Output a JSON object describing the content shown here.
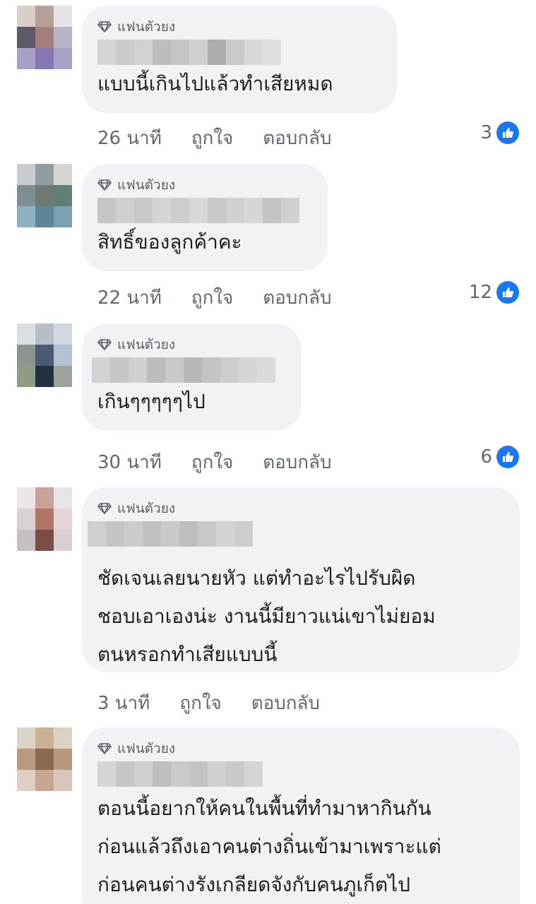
{
  "comments": [
    {
      "badge": "แฟนตัวยง",
      "text": "แบบนี้เกินไปแล้วทำเสียหมด",
      "time": "26 นาที",
      "like_label": "ถูกใจ",
      "reply_label": "ตอบกลับ",
      "reaction_count": "3"
    },
    {
      "badge": "แฟนตัวยง",
      "text": "สิทธิ์ของลูกค้าคะ",
      "time": "22 นาที",
      "like_label": "ถูกใจ",
      "reply_label": "ตอบกลับ",
      "reaction_count": "12"
    },
    {
      "badge": "แฟนตัวยง",
      "text": "เกินๆๆๆๆๆไป",
      "time": "30 นาที",
      "like_label": "ถูกใจ",
      "reply_label": "ตอบกลับ",
      "reaction_count": "6"
    },
    {
      "badge": "แฟนตัวยง",
      "text": "ชัดเจนเลยนายหัว แต่ทำอะไรไปรับผิด\nชอบเอาเองน่ะ งานนี้มียาวแน่เขาไม่ยอม\nตนหรอกทำเสียแบบนี้",
      "time": "3 นาที",
      "like_label": "ถูกใจ",
      "reply_label": "ตอบกลับ",
      "reaction_count": ""
    },
    {
      "badge": "แฟนตัวยง",
      "text": "ตอนนี้อยากให้คนในพื้นที่ทำมาหากินกัน\nก่อนแล้วถึงเอาคนต่างถิ่นเข้ามาเพราะแต่\nก่อนคนต่างรังเกลียดจังกับคนภูเก็ตไป",
      "time": "",
      "like_label": "",
      "reply_label": "",
      "reaction_count": ""
    }
  ],
  "colors": {
    "bubble_bg": "#f0f2f5",
    "like_blue": "#1877f2",
    "meta_text": "#606770"
  },
  "icons": {
    "badge": "diamond-icon",
    "reaction": "like-thumb-icon"
  }
}
